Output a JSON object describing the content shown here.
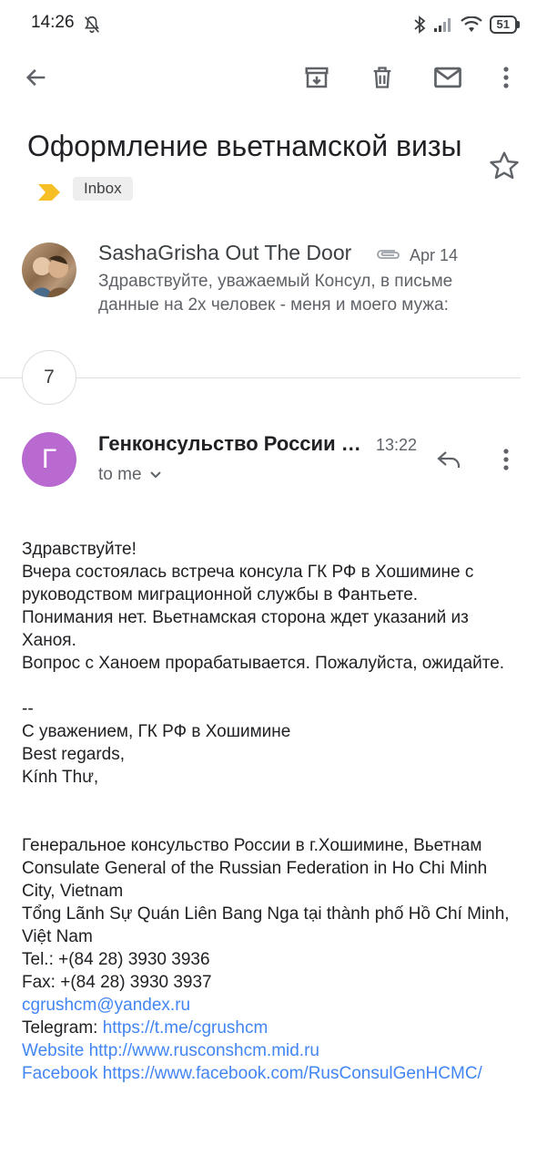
{
  "status_bar": {
    "time": "14:26",
    "battery": "51"
  },
  "email": {
    "subject": "Оформление вьетнамской визы",
    "label": "Inbox"
  },
  "thread_first": {
    "sender": "SashaGrisha Out The Door",
    "date": "Apr 14",
    "snippet": "Здравствуйте, уважаемый Консул, в письме данные на 2х человек - меня и моего мужа:"
  },
  "collapsed_count": "7",
  "message": {
    "avatar_letter": "Г",
    "sender": "Генконсульство России в г.Хошимине",
    "time": "13:22",
    "recipient": "to me",
    "body": {
      "greeting": "Здравствуйте!",
      "line1": "Вчера состоялась встреча консула ГК РФ в Хошимине с руководством миграционной службы в Фантьете.",
      "line2": "Понимания нет. Вьетнамская сторона ждет указаний из Ханоя.",
      "line3": "Вопрос с Ханоем прорабатывается. Пожалуйста, ожидайте.",
      "sig_sep": "--",
      "sig1": "С уважением, ГК РФ в Хошимине",
      "sig2": "Best regards,",
      "sig3": "Kính Thư,",
      "org_ru": "Генеральное консульство России в г.Хошимине, Вьетнам",
      "org_en": "Consulate General of the Russian Federation in Ho Chi Minh City, Vietnam",
      "org_vi": "Tổng Lãnh Sự Quán Liên Bang Nga tại thành phố Hồ Chí Minh, Việt Nam",
      "tel": "Tel.: +(84 28) 3930 3936",
      "fax": "Fax: +(84 28) 3930 3937",
      "email_link": "cgrushcm@yandex.ru",
      "telegram_label": "Telegram: ",
      "telegram_link": "https://t.me/cgrushcm",
      "website_link": "Website http://www.rusconshcm.mid.ru",
      "facebook_link": "Facebook https://www.facebook.com/RusConsulGenHCMC/"
    }
  },
  "colors": {
    "avatar_letter_bg": "#b86ad0",
    "link": "#4285f4",
    "important_marker": "#f6bf26"
  }
}
